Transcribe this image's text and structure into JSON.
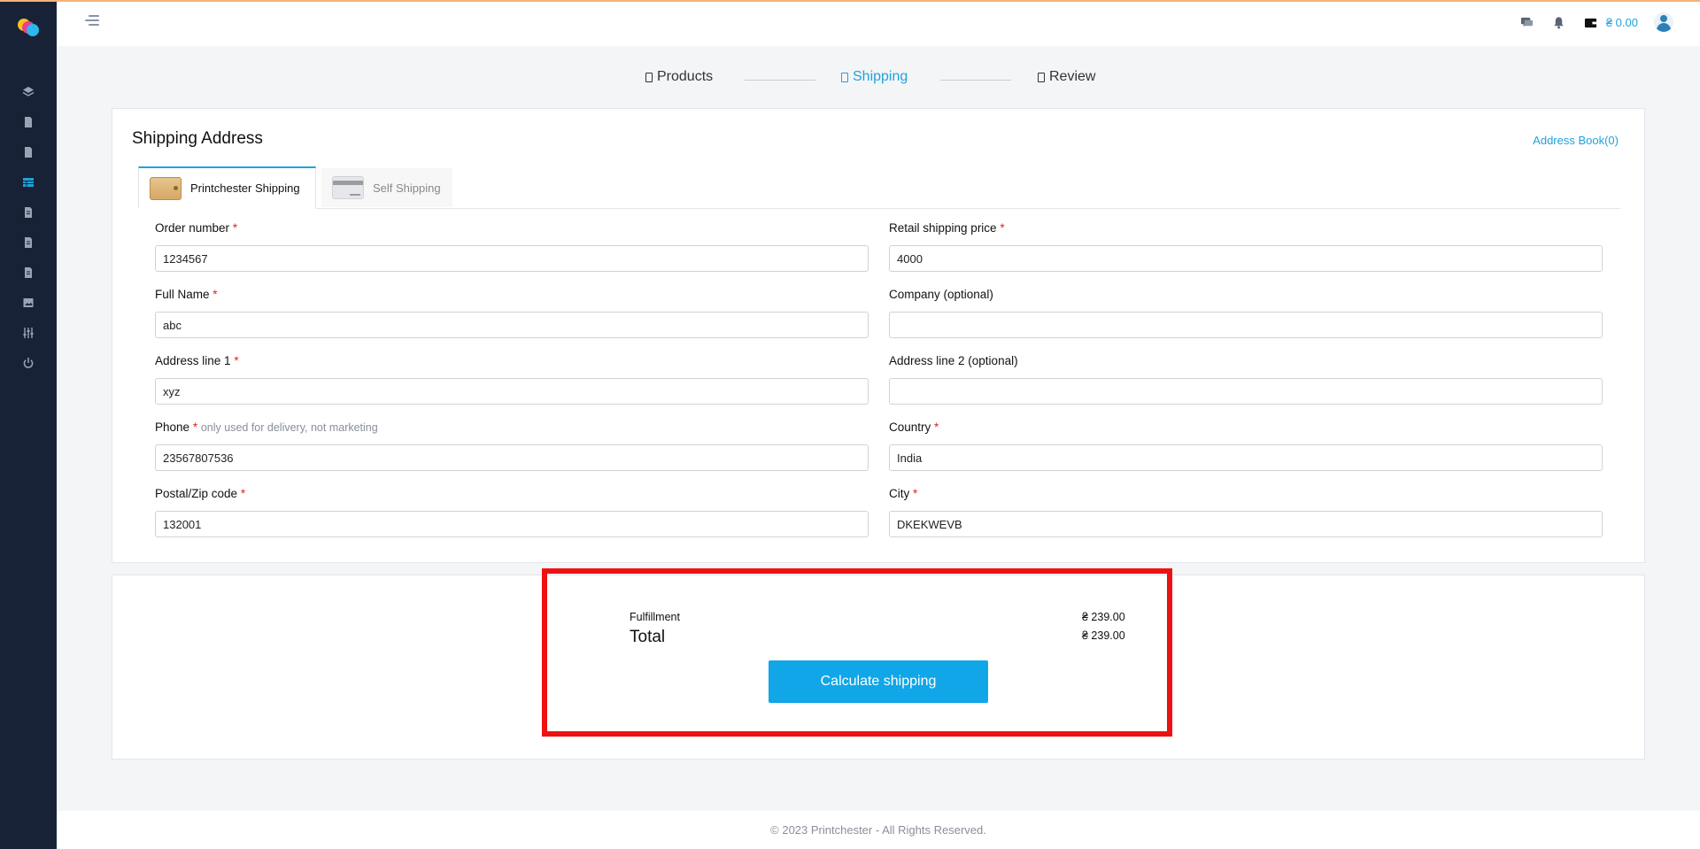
{
  "app": {
    "brand_colors": [
      "#f6c21c",
      "#ec3e8f",
      "#2bb7ee"
    ],
    "accent": "#1fa3d8"
  },
  "sidebar": {
    "items": [
      {
        "icon": "layers-icon"
      },
      {
        "icon": "file-icon"
      },
      {
        "icon": "file-icon"
      },
      {
        "icon": "table-icon",
        "active": true
      },
      {
        "icon": "document-icon"
      },
      {
        "icon": "document-icon"
      },
      {
        "icon": "document-icon"
      },
      {
        "icon": "image-icon"
      },
      {
        "icon": "sliders-icon"
      },
      {
        "icon": "power-icon"
      }
    ]
  },
  "header": {
    "icons": [
      "chat-icon",
      "bell-icon",
      "wallet-icon",
      "avatar"
    ],
    "wallet_amount": "₴ 0.00"
  },
  "stepper": {
    "steps": [
      {
        "label": "Products",
        "active": false
      },
      {
        "label": "Shipping",
        "active": true
      },
      {
        "label": "Review",
        "active": false
      }
    ]
  },
  "address": {
    "title": "Shipping Address",
    "address_book": "Address Book(0)",
    "tabs": [
      {
        "label": "Printchester Shipping",
        "active": true
      },
      {
        "label": "Self Shipping",
        "active": false
      }
    ],
    "fields": {
      "order_number": {
        "label": "Order number",
        "required": "*",
        "value": "1234567"
      },
      "retail_price": {
        "label": "Retail shipping price",
        "required": "*",
        "value": "4000"
      },
      "full_name": {
        "label": "Full Name",
        "required": "*",
        "value": "abc"
      },
      "company": {
        "label": "Company (optional)",
        "value": ""
      },
      "address1": {
        "label": "Address line 1",
        "required": "*",
        "value": "xyz"
      },
      "address2": {
        "label": "Address line 2 (optional)",
        "value": ""
      },
      "phone": {
        "label": "Phone",
        "required": "*",
        "hint": "only used for delivery, not marketing",
        "value": "23567807536"
      },
      "country": {
        "label": "Country",
        "required": "*",
        "value": "India"
      },
      "postal": {
        "label": "Postal/Zip code",
        "required": "*",
        "value": "132001"
      },
      "city": {
        "label": "City",
        "required": "*",
        "value": "DKEKWEVB"
      }
    }
  },
  "summary": {
    "fulfillment_label": "Fulfillment",
    "fulfillment_value": "₴ 239.00",
    "total_label": "Total",
    "total_value": "₴ 239.00",
    "button": "Calculate shipping",
    "highlight_color": "#ee1111"
  },
  "footer": {
    "text": "© 2023 Printchester - All Rights Reserved."
  }
}
